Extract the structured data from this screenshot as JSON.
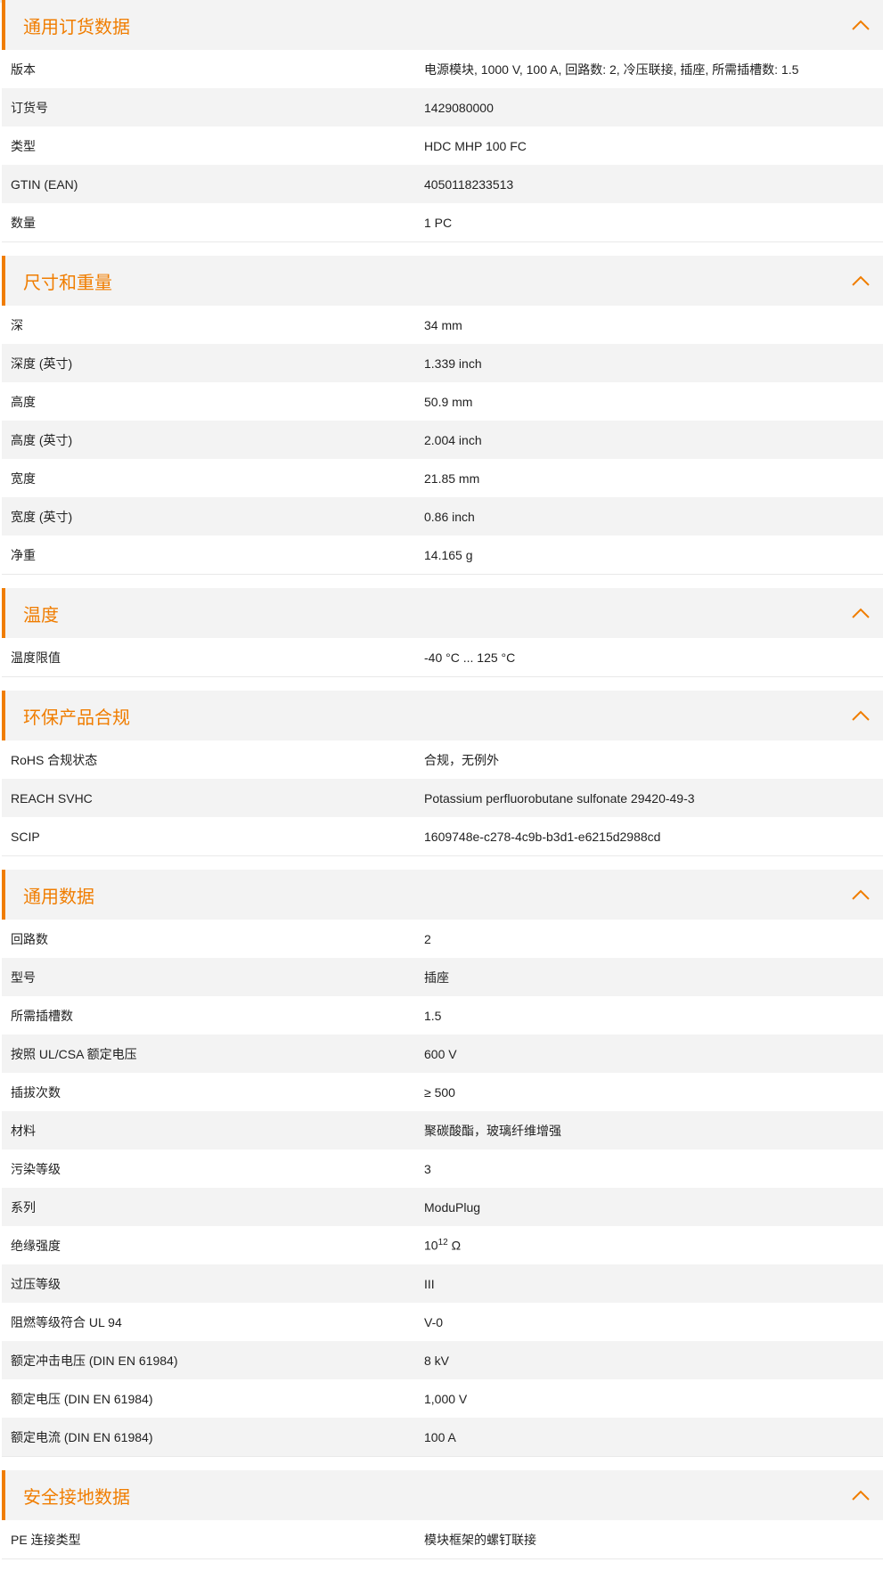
{
  "colors": {
    "accent": "#f07d00",
    "header_bg": "#f3f3f3",
    "row_alt": "#f3f3f3"
  },
  "sections": [
    {
      "title": "通用订货数据",
      "rows": [
        {
          "label": "版本",
          "value": "电源模块, 1000 V, 100 A, 回路数: 2, 冷压联接, 插座, 所需插槽数: 1.5"
        },
        {
          "label": "订货号",
          "value": "1429080000"
        },
        {
          "label": "类型",
          "value": "HDC MHP 100 FC"
        },
        {
          "label": "GTIN (EAN)",
          "value": "4050118233513"
        },
        {
          "label": "数量",
          "value": "1  PC"
        }
      ]
    },
    {
      "title": "尺寸和重量",
      "rows": [
        {
          "label": "深",
          "value": "34  mm"
        },
        {
          "label": "深度 (英寸)",
          "value": "1.339  inch"
        },
        {
          "label": "高度",
          "value": "50.9  mm"
        },
        {
          "label": "高度 (英寸)",
          "value": "2.004  inch"
        },
        {
          "label": "宽度",
          "value": "21.85  mm"
        },
        {
          "label": "宽度 (英寸)",
          "value": "0.86  inch"
        },
        {
          "label": "净重",
          "value": "14.165  g"
        }
      ]
    },
    {
      "title": "温度",
      "rows": [
        {
          "label": "温度限值",
          "value": "-40 °C ... 125 °C"
        }
      ]
    },
    {
      "title": "环保产品合规",
      "rows": [
        {
          "label": "RoHS 合规状态",
          "value": "合规，无例外"
        },
        {
          "label": "REACH SVHC",
          "value": "Potassium perfluorobutane sulfonate 29420-49-3"
        },
        {
          "label": "SCIP",
          "value": "1609748e-c278-4c9b-b3d1-e6215d2988cd"
        }
      ]
    },
    {
      "title": "通用数据",
      "rows": [
        {
          "label": "回路数",
          "value": "2"
        },
        {
          "label": "型号",
          "value": "插座"
        },
        {
          "label": "所需插槽数",
          "value": "1.5"
        },
        {
          "label": "按照 UL/CSA 额定电压",
          "value": "600 V"
        },
        {
          "label": "插拔次数",
          "value": "≥ 500"
        },
        {
          "label": "材料",
          "value": "聚碳酸酯，玻璃纤维增强"
        },
        {
          "label": "污染等级",
          "value": "3"
        },
        {
          "label": "系列",
          "value": "ModuPlug"
        },
        {
          "label": "绝缘强度",
          "value": "10",
          "sup": "12",
          "suffix": " Ω"
        },
        {
          "label": "过压等级",
          "value": "III"
        },
        {
          "label": "阻燃等级符合 UL 94",
          "value": "V-0"
        },
        {
          "label": "额定冲击电压 (DIN EN 61984)",
          "value": "8  kV"
        },
        {
          "label": "额定电压 (DIN EN 61984)",
          "value": "1,000  V"
        },
        {
          "label": "额定电流 (DIN EN 61984)",
          "value": "100  A"
        }
      ]
    },
    {
      "title": "安全接地数据",
      "rows": [
        {
          "label": "PE 连接类型",
          "value": "模块框架的螺钉联接"
        }
      ]
    }
  ]
}
